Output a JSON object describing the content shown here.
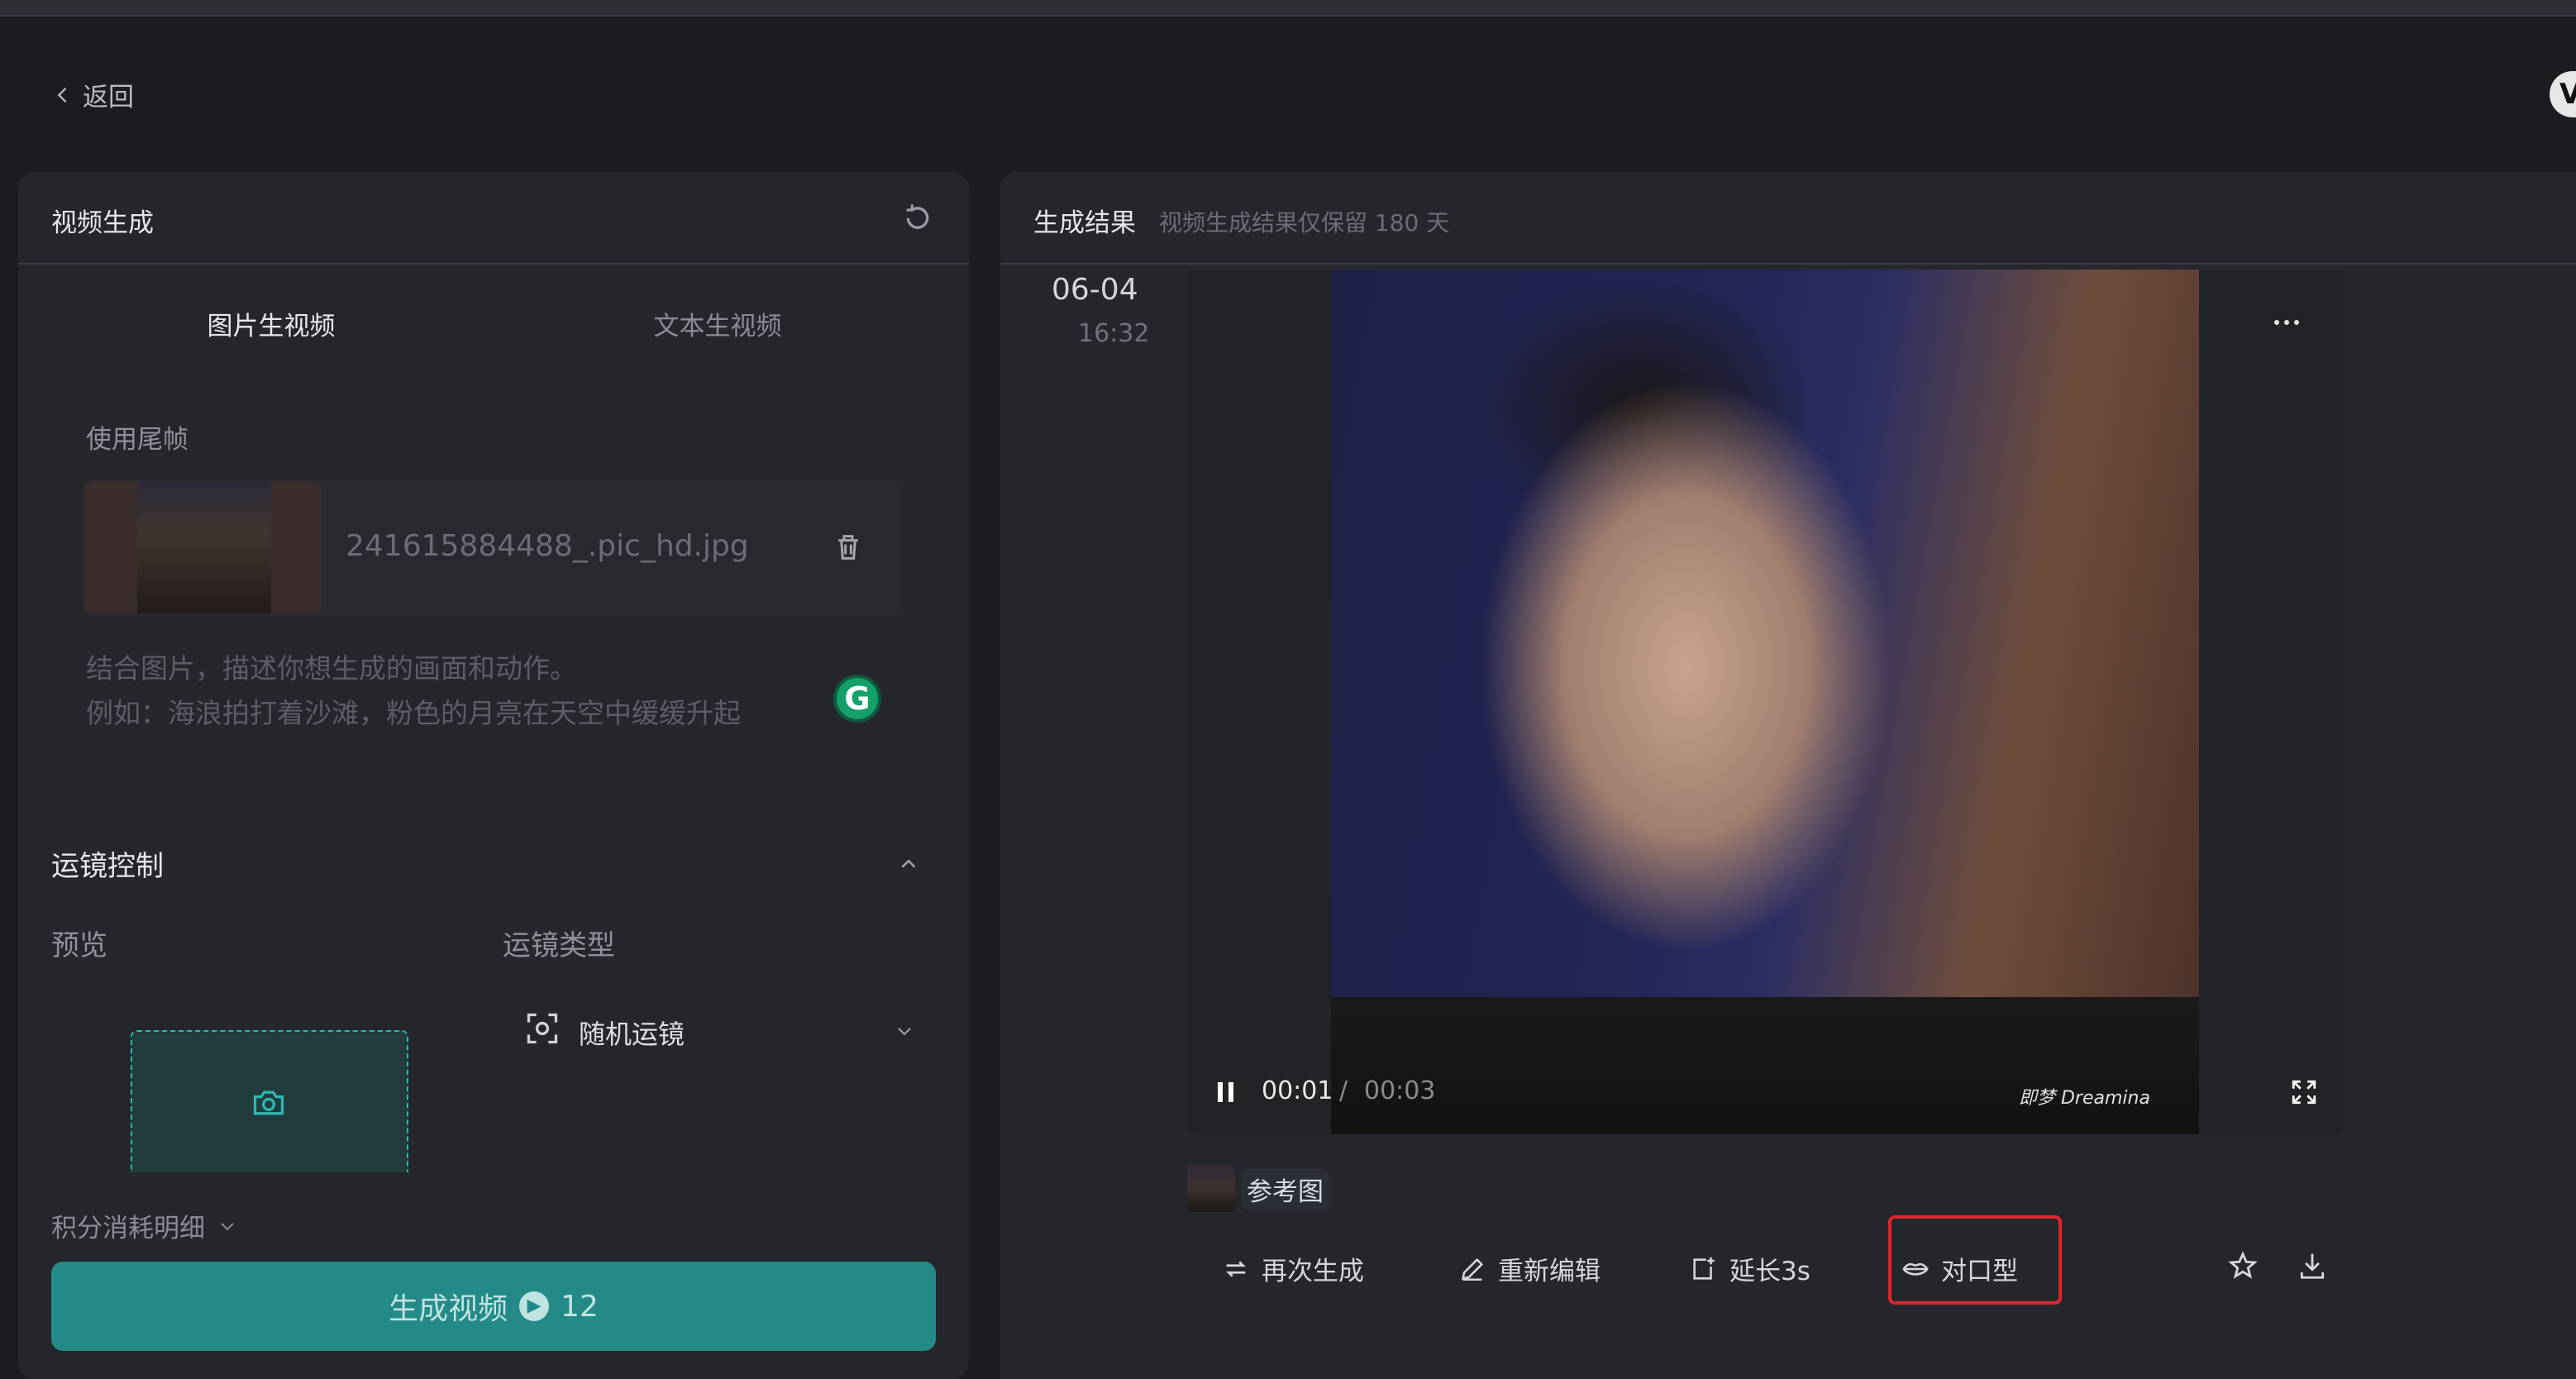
{
  "nav": {
    "back_label": "返回",
    "user_initial": "V"
  },
  "left_panel": {
    "title": "视频生成",
    "tabs": [
      {
        "label": "图片生视频"
      },
      {
        "label": "文本生视频"
      }
    ],
    "tail_frame_label": "使用尾帧",
    "file": {
      "name": "241615884488_.pic_hd.jpg"
    },
    "prompt": {
      "placeholder_line1": "结合图片，描述你想生成的画面和动作。",
      "placeholder_line2": "例如：海浪拍打着沙滩，粉色的月亮在天空中缓缓升起"
    },
    "grammarly_letter": "G",
    "camera": {
      "section_title": "运镜控制",
      "preview_label": "预览",
      "type_label": "运镜类型",
      "type_value": "随机运镜"
    },
    "credits_label": "积分消耗明细",
    "generate_button": {
      "label": "生成视频",
      "cost": "12"
    }
  },
  "right_panel": {
    "title": "生成结果",
    "subtitle": "视频生成结果仅保留 180 天",
    "item": {
      "date": "06-04",
      "time": "16:32",
      "video": {
        "current": "00:01",
        "separator": "/",
        "total": "00:03",
        "watermark": "即梦 Dreamina"
      },
      "reference_label": "参考图",
      "actions": [
        {
          "label": "再次生成",
          "icon": "regenerate-icon"
        },
        {
          "label": "重新编辑",
          "icon": "edit-icon"
        },
        {
          "label": "延长3s",
          "icon": "extend-icon"
        },
        {
          "label": "对口型",
          "icon": "lips-icon"
        }
      ]
    }
  },
  "colors": {
    "accent": "#238a87",
    "highlight": "#e0242c",
    "background": "#1b1d21"
  }
}
